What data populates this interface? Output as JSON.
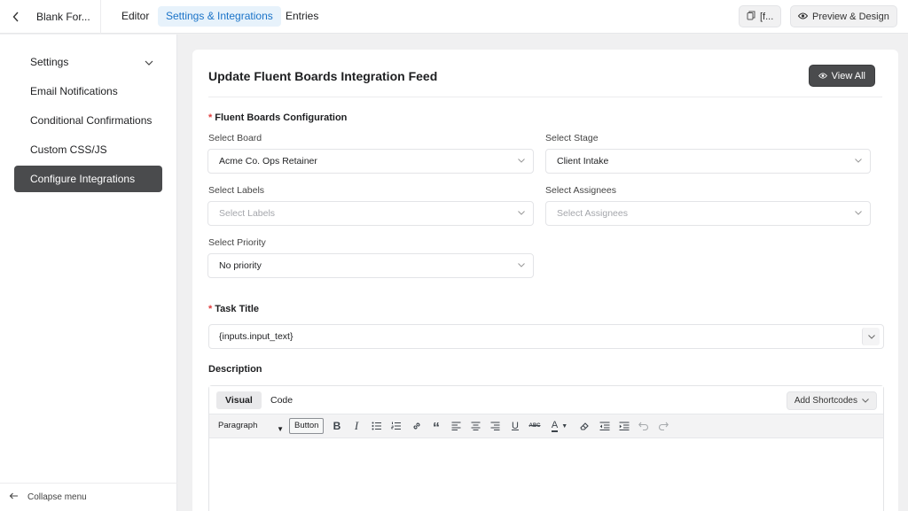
{
  "topbar": {
    "form_name": "Blank For...",
    "tabs": [
      {
        "label": "Editor"
      },
      {
        "label": "Settings & Integrations"
      },
      {
        "label": "Entries"
      }
    ],
    "shortcode_btn": "[f...",
    "preview_btn": "Preview & Design"
  },
  "sidebar": {
    "items": [
      {
        "label": "Settings"
      },
      {
        "label": "Email Notifications"
      },
      {
        "label": "Conditional Confirmations"
      },
      {
        "label": "Custom CSS/JS"
      },
      {
        "label": "Configure Integrations"
      }
    ],
    "collapse_label": "Collapse menu"
  },
  "card": {
    "title": "Update Fluent Boards Integration Feed",
    "view_all": "View All",
    "config_title": "Fluent Boards Configuration",
    "board": {
      "label": "Select Board",
      "value": "Acme Co. Ops Retainer"
    },
    "stage": {
      "label": "Select Stage",
      "value": "Client Intake"
    },
    "labels": {
      "label": "Select Labels",
      "placeholder": "Select Labels"
    },
    "assignees": {
      "label": "Select Assignees",
      "placeholder": "Select Assignees"
    },
    "priority": {
      "label": "Select Priority",
      "value": "No priority"
    },
    "task_title": {
      "label": "Task Title",
      "value": "{inputs.input_text}"
    },
    "description": {
      "label": "Description",
      "tabs": [
        {
          "label": "Visual"
        },
        {
          "label": "Code"
        }
      ],
      "add_shortcodes": "Add Shortcodes",
      "format_select": "Paragraph",
      "button_label": "Button"
    }
  },
  "colors": {
    "accent": "#1a73c8",
    "dark_button": "#4a4b4d",
    "required": "#e03d3d"
  }
}
